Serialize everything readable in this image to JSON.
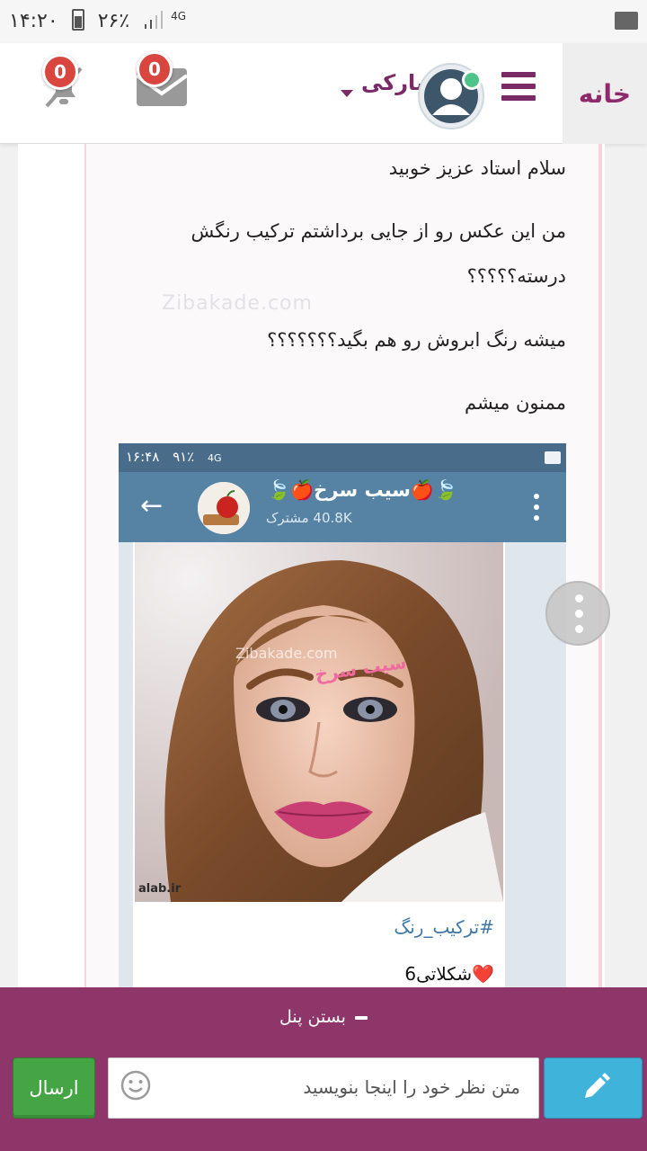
{
  "status_bar": {
    "time": "۱۴:۲۰",
    "battery": "۲۶٪",
    "network": "4G"
  },
  "header": {
    "home_label": "خانه",
    "username": "نیارکی",
    "mail_count": "0",
    "notification_count": "0",
    "colors": {
      "brand": "#7a2a66",
      "badge": "#d9463f",
      "online": "#4fc38a"
    }
  },
  "post": {
    "lines": [
      "سلام استاد عزیز خوبید",
      "من این عکس رو از جایی برداشتم  ترکیب رنگش",
      "درسته؟؟؟؟؟",
      "میشه رنگ ابروش رو هم بگید؟؟؟؟؟؟؟",
      "ممنون میشم"
    ],
    "watermark": "Zibakade.com"
  },
  "embedded_screenshot": {
    "time": "۱۶:۴۸",
    "battery": "۹۱٪",
    "network": "4G",
    "channel_title": "🍃🍎سیب سرخ🍎🍃",
    "subscribers": "40.8K مشترک",
    "photo_watermark": "Zibakade.com",
    "photo_caption": "سیب سرخ",
    "photo_credit": "alab.ir",
    "hashtag": "#ترکیب_رنگ",
    "color_name": "❤️شکلاتی6"
  },
  "panel": {
    "close_label": "بستن پنل",
    "send_label": "ارسال",
    "comment_placeholder": "متن نظر خود را اینجا بنویسید",
    "colors": {
      "panel": "#8e3669",
      "send": "#45a545",
      "edit": "#3fb3da"
    }
  }
}
